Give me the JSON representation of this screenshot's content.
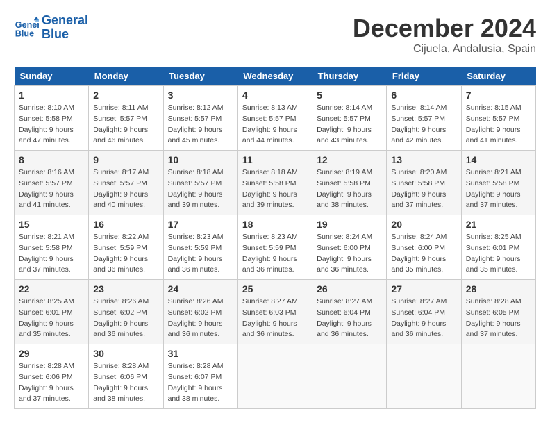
{
  "header": {
    "logo_line1": "General",
    "logo_line2": "Blue",
    "month": "December 2024",
    "location": "Cijuela, Andalusia, Spain"
  },
  "weekdays": [
    "Sunday",
    "Monday",
    "Tuesday",
    "Wednesday",
    "Thursday",
    "Friday",
    "Saturday"
  ],
  "weeks": [
    [
      {
        "day": "1",
        "info": "Sunrise: 8:10 AM\nSunset: 5:58 PM\nDaylight: 9 hours\nand 47 minutes."
      },
      {
        "day": "2",
        "info": "Sunrise: 8:11 AM\nSunset: 5:57 PM\nDaylight: 9 hours\nand 46 minutes."
      },
      {
        "day": "3",
        "info": "Sunrise: 8:12 AM\nSunset: 5:57 PM\nDaylight: 9 hours\nand 45 minutes."
      },
      {
        "day": "4",
        "info": "Sunrise: 8:13 AM\nSunset: 5:57 PM\nDaylight: 9 hours\nand 44 minutes."
      },
      {
        "day": "5",
        "info": "Sunrise: 8:14 AM\nSunset: 5:57 PM\nDaylight: 9 hours\nand 43 minutes."
      },
      {
        "day": "6",
        "info": "Sunrise: 8:14 AM\nSunset: 5:57 PM\nDaylight: 9 hours\nand 42 minutes."
      },
      {
        "day": "7",
        "info": "Sunrise: 8:15 AM\nSunset: 5:57 PM\nDaylight: 9 hours\nand 41 minutes."
      }
    ],
    [
      {
        "day": "8",
        "info": "Sunrise: 8:16 AM\nSunset: 5:57 PM\nDaylight: 9 hours\nand 41 minutes."
      },
      {
        "day": "9",
        "info": "Sunrise: 8:17 AM\nSunset: 5:57 PM\nDaylight: 9 hours\nand 40 minutes."
      },
      {
        "day": "10",
        "info": "Sunrise: 8:18 AM\nSunset: 5:57 PM\nDaylight: 9 hours\nand 39 minutes."
      },
      {
        "day": "11",
        "info": "Sunrise: 8:18 AM\nSunset: 5:58 PM\nDaylight: 9 hours\nand 39 minutes."
      },
      {
        "day": "12",
        "info": "Sunrise: 8:19 AM\nSunset: 5:58 PM\nDaylight: 9 hours\nand 38 minutes."
      },
      {
        "day": "13",
        "info": "Sunrise: 8:20 AM\nSunset: 5:58 PM\nDaylight: 9 hours\nand 37 minutes."
      },
      {
        "day": "14",
        "info": "Sunrise: 8:21 AM\nSunset: 5:58 PM\nDaylight: 9 hours\nand 37 minutes."
      }
    ],
    [
      {
        "day": "15",
        "info": "Sunrise: 8:21 AM\nSunset: 5:58 PM\nDaylight: 9 hours\nand 37 minutes."
      },
      {
        "day": "16",
        "info": "Sunrise: 8:22 AM\nSunset: 5:59 PM\nDaylight: 9 hours\nand 36 minutes."
      },
      {
        "day": "17",
        "info": "Sunrise: 8:23 AM\nSunset: 5:59 PM\nDaylight: 9 hours\nand 36 minutes."
      },
      {
        "day": "18",
        "info": "Sunrise: 8:23 AM\nSunset: 5:59 PM\nDaylight: 9 hours\nand 36 minutes."
      },
      {
        "day": "19",
        "info": "Sunrise: 8:24 AM\nSunset: 6:00 PM\nDaylight: 9 hours\nand 36 minutes."
      },
      {
        "day": "20",
        "info": "Sunrise: 8:24 AM\nSunset: 6:00 PM\nDaylight: 9 hours\nand 35 minutes."
      },
      {
        "day": "21",
        "info": "Sunrise: 8:25 AM\nSunset: 6:01 PM\nDaylight: 9 hours\nand 35 minutes."
      }
    ],
    [
      {
        "day": "22",
        "info": "Sunrise: 8:25 AM\nSunset: 6:01 PM\nDaylight: 9 hours\nand 35 minutes."
      },
      {
        "day": "23",
        "info": "Sunrise: 8:26 AM\nSunset: 6:02 PM\nDaylight: 9 hours\nand 36 minutes."
      },
      {
        "day": "24",
        "info": "Sunrise: 8:26 AM\nSunset: 6:02 PM\nDaylight: 9 hours\nand 36 minutes."
      },
      {
        "day": "25",
        "info": "Sunrise: 8:27 AM\nSunset: 6:03 PM\nDaylight: 9 hours\nand 36 minutes."
      },
      {
        "day": "26",
        "info": "Sunrise: 8:27 AM\nSunset: 6:04 PM\nDaylight: 9 hours\nand 36 minutes."
      },
      {
        "day": "27",
        "info": "Sunrise: 8:27 AM\nSunset: 6:04 PM\nDaylight: 9 hours\nand 36 minutes."
      },
      {
        "day": "28",
        "info": "Sunrise: 8:28 AM\nSunset: 6:05 PM\nDaylight: 9 hours\nand 37 minutes."
      }
    ],
    [
      {
        "day": "29",
        "info": "Sunrise: 8:28 AM\nSunset: 6:06 PM\nDaylight: 9 hours\nand 37 minutes."
      },
      {
        "day": "30",
        "info": "Sunrise: 8:28 AM\nSunset: 6:06 PM\nDaylight: 9 hours\nand 38 minutes."
      },
      {
        "day": "31",
        "info": "Sunrise: 8:28 AM\nSunset: 6:07 PM\nDaylight: 9 hours\nand 38 minutes."
      },
      {
        "day": "",
        "info": ""
      },
      {
        "day": "",
        "info": ""
      },
      {
        "day": "",
        "info": ""
      },
      {
        "day": "",
        "info": ""
      }
    ]
  ]
}
